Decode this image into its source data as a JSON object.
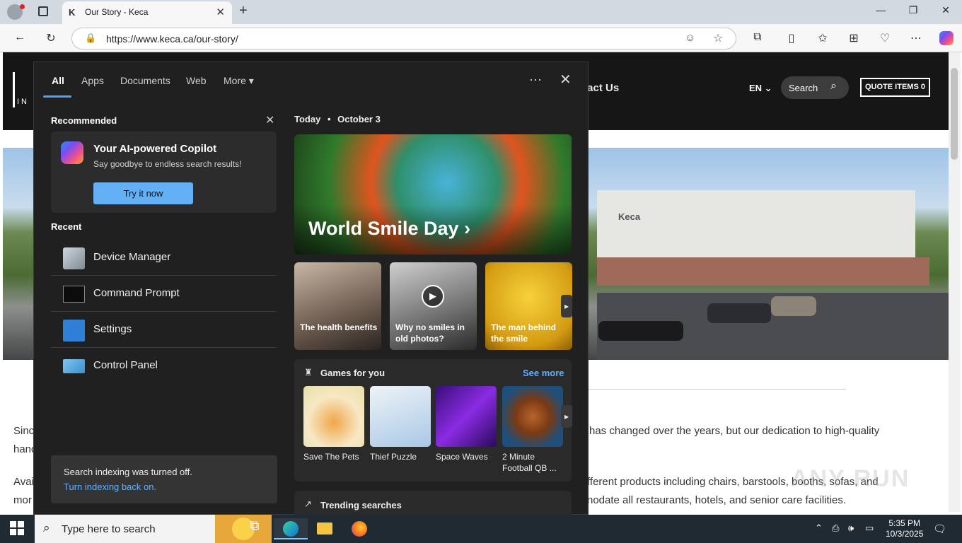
{
  "browser": {
    "tab_title": "Our Story - Keca",
    "url": "https://www.keca.ca/our-story/"
  },
  "site": {
    "nav_contact": "ntact Us",
    "lang": "EN",
    "search_label": "Search",
    "quote_label": "QUOTE ITEMS 0",
    "logo_text": "IN",
    "building_logo": "Keca",
    "para1_left": "Sinc",
    "para1_left2": "hand",
    "para1_right": "has changed over the years, but our dedication to high-quality",
    "para2_left": "Avai",
    "para2_left2": "mor",
    "para2_right": "fferent products including chairs, barstools, booths, sofas, and",
    "para2_right2": "nodate all restaurants, hotels, and senior care facilities."
  },
  "search_panel": {
    "tabs": [
      "All",
      "Apps",
      "Documents",
      "Web",
      "More"
    ],
    "recommended_title": "Recommended",
    "copilot_title": "Your AI-powered Copilot",
    "copilot_sub": "Say goodbye to endless search results!",
    "try_label": "Try it now",
    "recent_title": "Recent",
    "recent": [
      {
        "label": "Device Manager"
      },
      {
        "label": "Command Prompt"
      },
      {
        "label": "Settings"
      },
      {
        "label": "Control Panel"
      }
    ],
    "indexing_text": "Search indexing was turned off.",
    "indexing_link": "Turn indexing back on.",
    "today_label": "Today",
    "today_date": "October 3",
    "hero_title": "World Smile Day",
    "stories": [
      {
        "label": "The health benefits"
      },
      {
        "label": "Why no smiles in old photos?"
      },
      {
        "label": "The man behind the smile"
      }
    ],
    "games_title": "Games for you",
    "see_more": "See more",
    "games": [
      {
        "label": "Save The Pets"
      },
      {
        "label": "Thief Puzzle"
      },
      {
        "label": "Space Waves"
      },
      {
        "label": "2 Minute Football QB ..."
      }
    ],
    "trending": "Trending searches"
  },
  "taskbar": {
    "search_placeholder": "Type here to search",
    "time": "5:35 PM",
    "date": "10/3/2025"
  },
  "watermark": "ANY RUN",
  "colors": {
    "accent": "#63b0f5",
    "link": "#5fb2ff",
    "panel_bg": "#202020"
  }
}
